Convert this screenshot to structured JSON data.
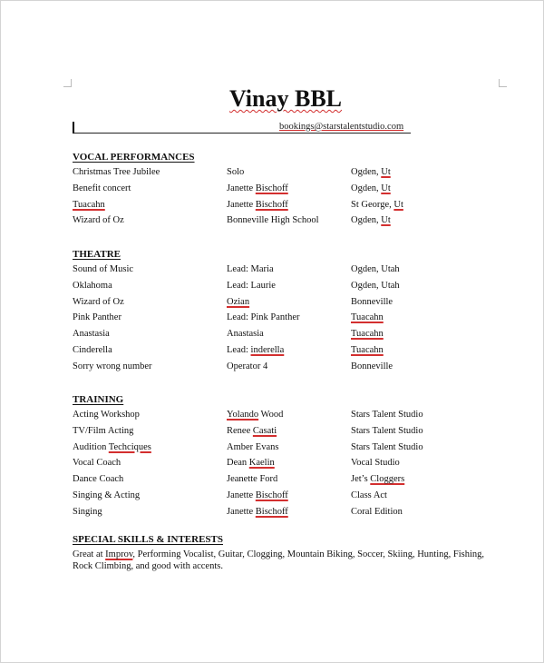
{
  "document": {
    "name": "Vinay BBL",
    "email": "bookings@starstalentstudio.com"
  },
  "sections": {
    "vocal": {
      "heading": "VOCAL PERFORMANCES",
      "rows": [
        {
          "event": "Christmas Tree Jubilee",
          "role": "Solo",
          "location": "Ogden, Ut"
        },
        {
          "event": "Benefit concert",
          "role": "Janette Bischoff",
          "location": "Ogden, Ut"
        },
        {
          "event": "Tuacahn",
          "role": "Janette Bischoff",
          "location": "St George, Ut"
        },
        {
          "event": "Wizard of Oz",
          "role": "Bonneville High School",
          "location": "Ogden, Ut"
        }
      ]
    },
    "theatre": {
      "heading": "THEATRE",
      "rows": [
        {
          "event": "Sound of Music",
          "role": "Lead: Maria",
          "location": "Ogden, Utah"
        },
        {
          "event": "Oklahoma",
          "role": "Lead: Laurie",
          "location": "Ogden, Utah"
        },
        {
          "event": "Wizard of Oz",
          "role": "Ozian",
          "location": "Bonneville"
        },
        {
          "event": "Pink Panther",
          "role": "Lead: Pink Panther",
          "location": "Tuacahn"
        },
        {
          "event": "Anastasia",
          "role": "Anastasia",
          "location": "Tuacahn"
        },
        {
          "event": "Cinderella",
          "role": "Lead: inderella",
          "location": "Tuacahn"
        },
        {
          "event": "Sorry wrong number",
          "role": "Operator 4",
          "location": "Bonneville"
        }
      ]
    },
    "training": {
      "heading": "TRAINING",
      "rows": [
        {
          "event": "Acting Workshop",
          "role": "Yolando Wood",
          "location": "Stars Talent Studio"
        },
        {
          "event": "TV/Film Acting",
          "role": "Renee Casati",
          "location": "Stars Talent Studio"
        },
        {
          "event": "Audition Techciques",
          "role": "Amber Evans",
          "location": "Stars Talent Studio"
        },
        {
          "event": "Vocal Coach",
          "role": "Dean Kaelin",
          "location": "Vocal Studio"
        },
        {
          "event": "Dance Coach",
          "role": "Jeanette Ford",
          "location": "Jet’s Cloggers"
        },
        {
          "event": "Singing & Acting",
          "role": "Janette Bischoff",
          "location": "Class Act"
        },
        {
          "event": "Singing",
          "role": "Janette Bischoff",
          "location": "Coral Edition"
        }
      ]
    },
    "skills": {
      "heading": "SPECIAL SKILLS & INTERESTS",
      "text": "Great at Improv, Performing Vocalist, Guitar, Clogging, Mountain Biking, Soccer, Skiing, Hunting, Fishing, Rock Climbing, and good with accents."
    }
  },
  "colors": {
    "spellcheck_underline": "#d32f2f",
    "page_border": "#d4d4d4"
  }
}
